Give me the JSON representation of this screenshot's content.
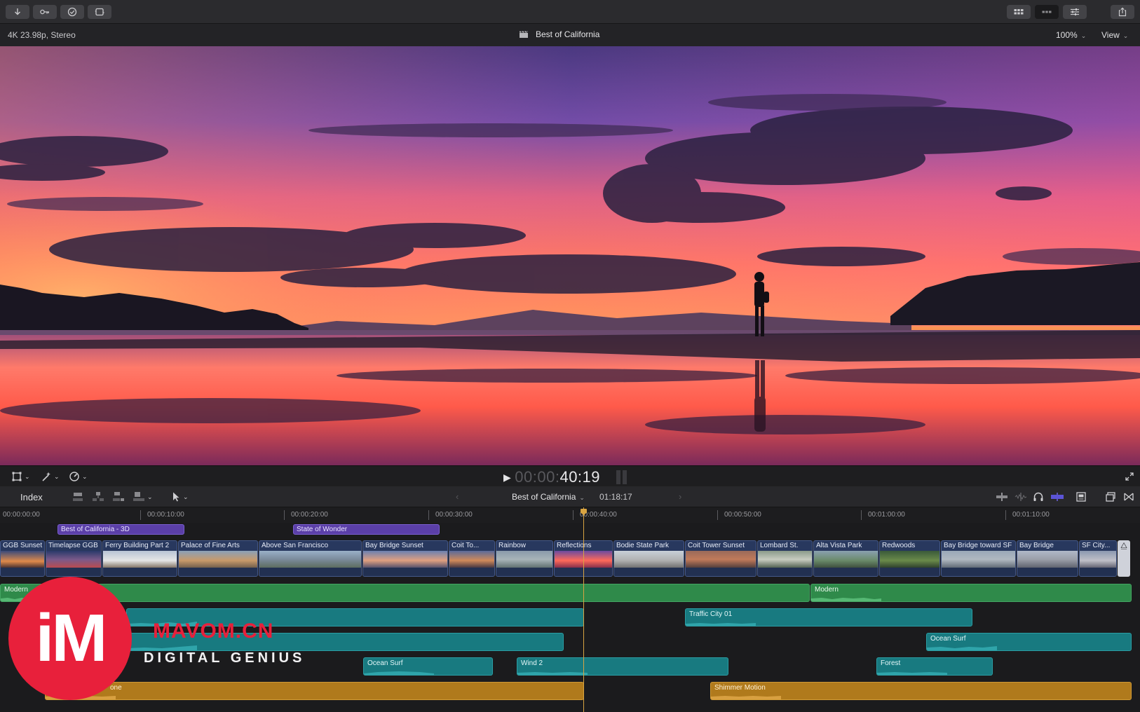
{
  "toolbar": {
    "left_icons": [
      "import-icon",
      "keywords-icon",
      "background-tasks-icon",
      "share-icon"
    ],
    "right_icons": [
      "browser-layout-icon",
      "timeline-layout-icon",
      "inspector-icon",
      "share-export-icon"
    ]
  },
  "viewer_header": {
    "format": "4K 23.98p, Stereo",
    "project": "Best of California",
    "zoom": "100%",
    "view": "View"
  },
  "transport": {
    "timecode_dim": "00:00:",
    "timecode_bright": "40:19"
  },
  "timeline_header": {
    "index": "Index",
    "project": "Best of California",
    "duration": "01:18:17"
  },
  "ruler": {
    "labels": [
      "00:00:00:00",
      "00:00:10:00",
      "00:00:20:00",
      "00:00:30:00",
      "00:00:40:00",
      "00:00:50:00",
      "00:01:00:00",
      "00:01:10:00"
    ]
  },
  "titles": [
    {
      "label": "Best of California - 3D"
    },
    {
      "label": "State of Wonder"
    }
  ],
  "video_clips": [
    {
      "label": "GGB Sunset"
    },
    {
      "label": "Timelapse GGB"
    },
    {
      "label": "Ferry Building Part 2"
    },
    {
      "label": "Palace of Fine Arts"
    },
    {
      "label": "Above San Francisco"
    },
    {
      "label": "Bay Bridge Sunset"
    },
    {
      "label": "Coit To..."
    },
    {
      "label": "Rainbow"
    },
    {
      "label": "Reflections"
    },
    {
      "label": "Bodie State Park"
    },
    {
      "label": "Coit Tower Sunset"
    },
    {
      "label": "Lombard St."
    },
    {
      "label": "Alta Vista Park"
    },
    {
      "label": "Redwoods"
    },
    {
      "label": "Bay Bridge toward SF"
    },
    {
      "label": "Bay Bridge"
    },
    {
      "label": "SF City..."
    }
  ],
  "audio_clips": [
    {
      "label": "Modern"
    },
    {
      "label": "Modern"
    },
    {
      "label": "Traffic City 01"
    },
    {
      "label": "Ocean Surf"
    },
    {
      "label": "Ocean Surf"
    },
    {
      "label": "Wind 2"
    },
    {
      "label": "Forest"
    },
    {
      "label": "one"
    },
    {
      "label": "Shimmer Motion"
    }
  ],
  "watermark": {
    "logo": "iM",
    "site": "MAVOM.CN",
    "tagline": "DIGITAL GENIUS"
  },
  "colors": {
    "title_clip": "#5b3fa8",
    "video_clip": "#28385e",
    "music": "#2f8a4a",
    "sound_effects": "#187a80",
    "ambience": "#b07a1c",
    "playhead": "#d9a441",
    "watermark_red": "#e8203b"
  }
}
